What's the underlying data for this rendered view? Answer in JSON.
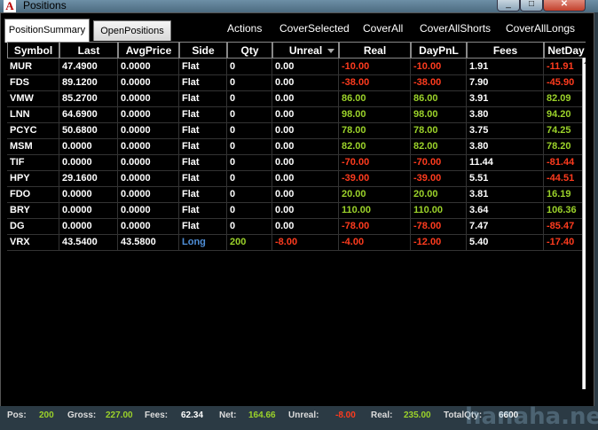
{
  "window": {
    "title": "Positions",
    "app_icon_letter": "A"
  },
  "tabs": [
    {
      "label": "PositionSummary",
      "active": true
    },
    {
      "label": "OpenPositions",
      "active": false
    }
  ],
  "actions": [
    "Actions",
    "CoverSelected",
    "CoverAll",
    "CoverAllShorts",
    "CoverAllLongs"
  ],
  "columns": [
    "Symbol",
    "Last",
    "AvgPrice",
    "Side",
    "Qty",
    "Unreal",
    "Real",
    "DayPnL",
    "Fees",
    "NetDay"
  ],
  "rows": [
    {
      "symbol": "MUR",
      "last": "47.4900",
      "avg": "0.0000",
      "side": "Flat",
      "qty": "0",
      "unreal": "0.00",
      "real": "-10.00",
      "daypnl": "-10.00",
      "fees": "1.91",
      "netday": "-11.91"
    },
    {
      "symbol": "FDS",
      "last": "89.1200",
      "avg": "0.0000",
      "side": "Flat",
      "qty": "0",
      "unreal": "0.00",
      "real": "-38.00",
      "daypnl": "-38.00",
      "fees": "7.90",
      "netday": "-45.90"
    },
    {
      "symbol": "VMW",
      "last": "85.2700",
      "avg": "0.0000",
      "side": "Flat",
      "qty": "0",
      "unreal": "0.00",
      "real": "86.00",
      "daypnl": "86.00",
      "fees": "3.91",
      "netday": "82.09"
    },
    {
      "symbol": "LNN",
      "last": "64.6900",
      "avg": "0.0000",
      "side": "Flat",
      "qty": "0",
      "unreal": "0.00",
      "real": "98.00",
      "daypnl": "98.00",
      "fees": "3.80",
      "netday": "94.20"
    },
    {
      "symbol": "PCYC",
      "last": "50.6800",
      "avg": "0.0000",
      "side": "Flat",
      "qty": "0",
      "unreal": "0.00",
      "real": "78.00",
      "daypnl": "78.00",
      "fees": "3.75",
      "netday": "74.25"
    },
    {
      "symbol": "MSM",
      "last": "0.0000",
      "avg": "0.0000",
      "side": "Flat",
      "qty": "0",
      "unreal": "0.00",
      "real": "82.00",
      "daypnl": "82.00",
      "fees": "3.80",
      "netday": "78.20"
    },
    {
      "symbol": "TIF",
      "last": "0.0000",
      "avg": "0.0000",
      "side": "Flat",
      "qty": "0",
      "unreal": "0.00",
      "real": "-70.00",
      "daypnl": "-70.00",
      "fees": "11.44",
      "netday": "-81.44"
    },
    {
      "symbol": "HPY",
      "last": "29.1600",
      "avg": "0.0000",
      "side": "Flat",
      "qty": "0",
      "unreal": "0.00",
      "real": "-39.00",
      "daypnl": "-39.00",
      "fees": "5.51",
      "netday": "-44.51"
    },
    {
      "symbol": "FDO",
      "last": "0.0000",
      "avg": "0.0000",
      "side": "Flat",
      "qty": "0",
      "unreal": "0.00",
      "real": "20.00",
      "daypnl": "20.00",
      "fees": "3.81",
      "netday": "16.19"
    },
    {
      "symbol": "BRY",
      "last": "0.0000",
      "avg": "0.0000",
      "side": "Flat",
      "qty": "0",
      "unreal": "0.00",
      "real": "110.00",
      "daypnl": "110.00",
      "fees": "3.64",
      "netday": "106.36"
    },
    {
      "symbol": "DG",
      "last": "0.0000",
      "avg": "0.0000",
      "side": "Flat",
      "qty": "0",
      "unreal": "0.00",
      "real": "-78.00",
      "daypnl": "-78.00",
      "fees": "7.47",
      "netday": "-85.47"
    },
    {
      "symbol": "VRX",
      "last": "43.5400",
      "avg": "43.5800",
      "side": "Long",
      "qty": "200",
      "unreal": "-8.00",
      "real": "-4.00",
      "daypnl": "-12.00",
      "fees": "5.40",
      "netday": "-17.40"
    }
  ],
  "status": {
    "pos_label": "Pos:",
    "pos": "200",
    "gross_label": "Gross:",
    "gross": "227.00",
    "fees_label": "Fees:",
    "fees": "62.34",
    "net_label": "Net:",
    "net": "164.66",
    "unreal_label": "Unreal:",
    "unreal": "-8.00",
    "real_label": "Real:",
    "real": "235.00",
    "totalqty_label": "TotalQty:",
    "totalqty": "6600"
  },
  "watermark": "hanaha.net",
  "colors": {
    "positive": "#9bd22a",
    "negative": "#ff3b1e",
    "long": "#4f8fd8",
    "background": "#000000"
  }
}
